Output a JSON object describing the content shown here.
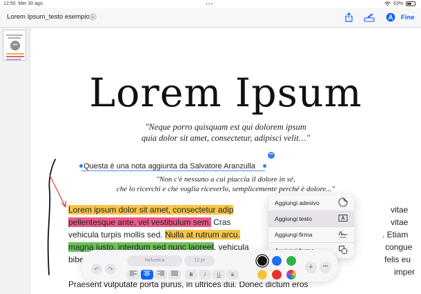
{
  "status_bar": {
    "time": "12:50",
    "date": "Mer 30 ago",
    "battery": "63%",
    "battery_level": 0.63
  },
  "nav": {
    "doc_title": "Lorem Ipsum_testo esempio",
    "done_label": "Fine",
    "icons": [
      "share-icon",
      "markup-pen-icon",
      "autofill-icon"
    ],
    "accent_color": "#0a63ff"
  },
  "document": {
    "headline": "Lorem Ipsum",
    "quote1_line1": "\"Neque porro quisquam est qui dolorem ipsum",
    "quote1_line2": "quia dolor sit amet, consectetur, adipisci velit…\"",
    "note": "Questa è una nota aggiunta da Salvatore Aranzulla",
    "quote2_line1": "\"Non c'è nessuno a cui piaccia il dolore in sé,",
    "quote2_line2": "che lo ricerchi e che voglia riceverlo, semplicemente perché è dolore...\"",
    "body": {
      "l1_hl": "Lorem ipsum dolor sit amet, consectetur adip",
      "l1_end": "vitae",
      "l2_hl": "pellentesque ante, vel vestibulum sem.",
      "l2_rest": " Cras",
      "l2_end": "vitae",
      "l3_a": "vehicula turpis mollis sed. ",
      "l3_hl": "Nulla at rutrum arcu.",
      "l3_end": ". Etiam",
      "l4_hl": "magna justo, interdum sed nunc laoreet",
      "l4_rest": ", vehicula",
      "l4_end": "congue",
      "l5_a": "bibe",
      "l5_end": "felis eu",
      "l6_end": "imper",
      "l7": "Praesent vulputate porta purus, in ultrices dui. Donec dictum eros"
    }
  },
  "popup_menu": {
    "items": [
      {
        "label": "Aggiungi adesivo",
        "icon": "sticker-icon"
      },
      {
        "label": "Aggiungi testo",
        "icon": "text-box-icon"
      },
      {
        "label": "Aggiungi firma",
        "icon": "signature-icon"
      },
      {
        "label": "Aggiungi forma",
        "icon": "shapes-icon"
      }
    ],
    "selected": "Aggiungi testo"
  },
  "toolbar": {
    "font": "Helvetica",
    "size": "12 pt",
    "format_buttons": [
      "align-left",
      "align-center",
      "align-right",
      "align-justify",
      "B",
      "I",
      "U",
      "S"
    ],
    "active_format": "align-center",
    "colors": [
      "#111111",
      "#1f6ff0",
      "#2fb34a",
      "#f5c33b",
      "#e5352b",
      "color-wheel"
    ],
    "selected_color": "#111111"
  }
}
